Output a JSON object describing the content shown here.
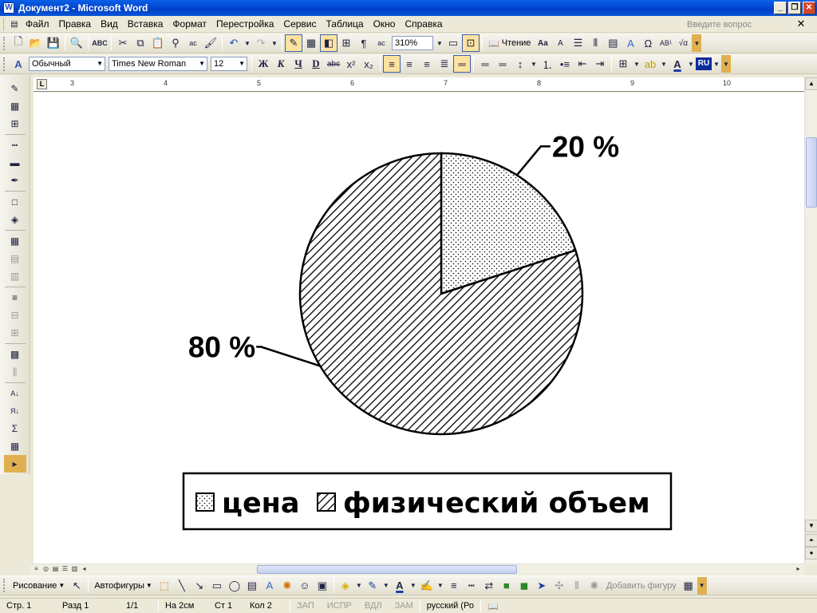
{
  "window": {
    "title": "Документ2 - Microsoft Word",
    "app_icon": "W"
  },
  "menu": {
    "items": [
      "Файл",
      "Правка",
      "Вид",
      "Вставка",
      "Формат",
      "Перестройка",
      "Сервис",
      "Таблица",
      "Окно",
      "Справка"
    ],
    "help_placeholder": "Введите вопрос"
  },
  "standard_toolbar": {
    "zoom": "310%",
    "reading_label": "Чтение"
  },
  "formatting_toolbar": {
    "style": "Обычный",
    "font": "Times New Roman",
    "size": "12",
    "bold_label": "Ж",
    "italic_label": "К",
    "underline_label": "Ч",
    "language_badge": "RU"
  },
  "ruler": {
    "numbers": [
      "3",
      "4",
      "5",
      "6",
      "7",
      "8",
      "9",
      "10"
    ]
  },
  "chart_data": {
    "type": "pie",
    "categories": [
      "цена",
      "физический объем"
    ],
    "values": [
      20,
      80
    ],
    "labels": [
      "20 %",
      "80 %"
    ],
    "fills": [
      "dotted",
      "hatched"
    ],
    "legend": {
      "placement": "bottom",
      "entries": [
        "цена",
        "физический объем"
      ]
    }
  },
  "draw_toolbar": {
    "draw_label": "Рисование",
    "autoshapes_label": "Автофигуры",
    "add_shape_label": "Добавить фигуру"
  },
  "status": {
    "page": "Стр. 1",
    "section": "Разд 1",
    "pages": "1/1",
    "at": "На 2см",
    "line": "Ст 1",
    "col": "Кол 2",
    "rec": "ЗАП",
    "trk": "ИСПР",
    "ext": "ВДЛ",
    "ovr": "ЗАМ",
    "language": "русский (Ро"
  }
}
